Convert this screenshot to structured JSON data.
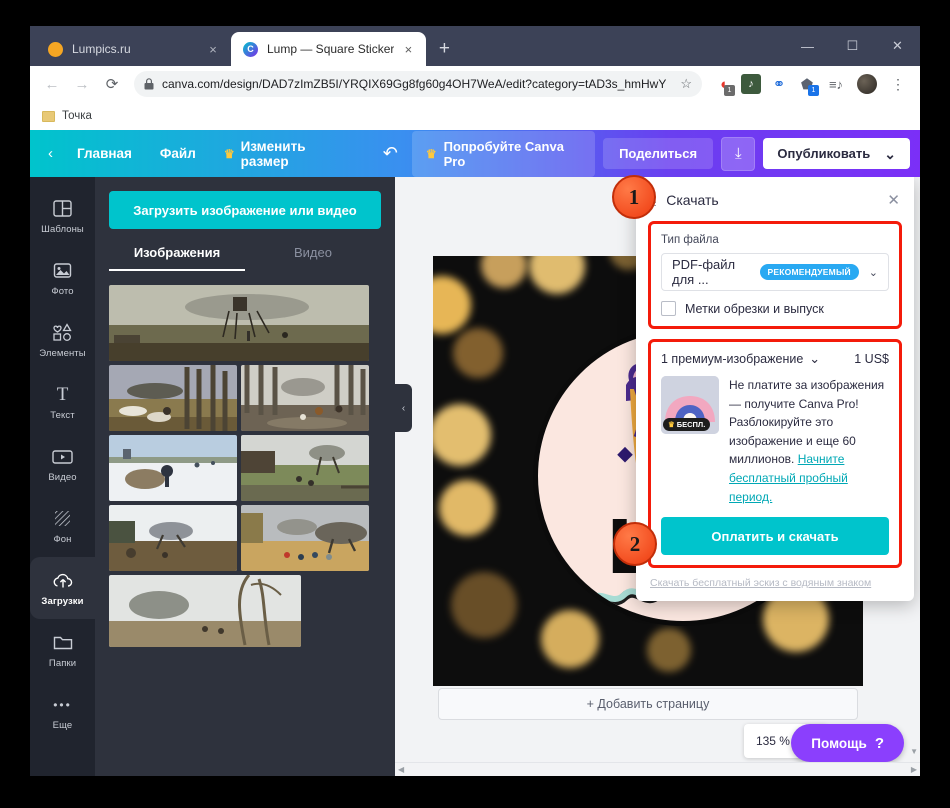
{
  "browser": {
    "tabs": [
      {
        "title": "Lumpics.ru",
        "favicon": "orange-dot-icon",
        "active": false,
        "close_label": "×"
      },
      {
        "title": "Lump — Square Sticker",
        "favicon": "canva-icon",
        "active": true,
        "close_label": "×"
      }
    ],
    "new_tab_label": "+",
    "window_controls": {
      "minimize": "—",
      "maximize": "☐",
      "close": "✕"
    },
    "nav": {
      "back": "←",
      "forward": "→",
      "reload": "⟳"
    },
    "omnibox": {
      "lock_icon": "lock-icon",
      "url": "canva.com/design/DAD7zImZB5I/YRQIX69Gg8fg60g4OH7WeA/edit?category=tAD3s_hmHwY",
      "star": "☆"
    },
    "extensions": [
      {
        "name": "recorder-extension-icon",
        "glyph": "◔",
        "color": "#e8372c",
        "badge": "1",
        "badge_color": "#6b6b6b"
      },
      {
        "name": "music-extension-icon",
        "glyph": "♫",
        "color": "#3d5a3d",
        "badge": "",
        "badge_color": ""
      },
      {
        "name": "globe-extension-icon",
        "glyph": "⊕",
        "color": "#1565d8",
        "badge": "",
        "badge_color": ""
      },
      {
        "name": "box-extension-icon",
        "glyph": "⬟",
        "color": "#5c6370",
        "badge": "1",
        "badge_color": "#1a73e8"
      }
    ],
    "downloads_icon": "downloads-list-icon",
    "profile_icon": "avatar-icon",
    "menu_icon": "⋮",
    "bookmarks": [
      {
        "label": "Точка",
        "icon": "folder-icon"
      }
    ]
  },
  "canva": {
    "toolbar": {
      "back_chevron": "‹",
      "home": "Главная",
      "file": "Файл",
      "resize": "Изменить размер",
      "crown": "♛",
      "undo": "↶",
      "try_pro": "Попробуйте Canva Pro",
      "share": "Поделиться",
      "download_icon": "⤓",
      "publish": "Опубликовать",
      "publish_chevron": "⌄"
    },
    "rail": [
      {
        "label": "Шаблоны",
        "icon": "templates-icon",
        "glyph": "◫",
        "active": false
      },
      {
        "label": "Фото",
        "icon": "photo-icon",
        "glyph": "⛰",
        "active": false
      },
      {
        "label": "Элементы",
        "icon": "elements-icon",
        "glyph": "⬡",
        "active": false
      },
      {
        "label": "Текст",
        "icon": "text-icon",
        "glyph": "T",
        "active": false
      },
      {
        "label": "Видео",
        "icon": "video-icon",
        "glyph": "▶",
        "active": false
      },
      {
        "label": "Фон",
        "icon": "background-icon",
        "glyph": "░",
        "active": false
      },
      {
        "label": "Загрузки",
        "icon": "uploads-cloud-icon",
        "glyph": "☁",
        "active": true
      },
      {
        "label": "Папки",
        "icon": "folders-icon",
        "glyph": "◱",
        "active": false
      },
      {
        "label": "Еще",
        "icon": "more-dots-icon",
        "glyph": "•••",
        "active": false
      }
    ],
    "uploads": {
      "upload_button": "Загрузить изображение или видео",
      "tabs": [
        {
          "label": "Изображения",
          "active": true
        },
        {
          "label": "Видео",
          "active": false
        }
      ],
      "collapse_chevron": "‹"
    },
    "editor": {
      "add_page": "+ Добавить страницу",
      "zoom_value": "135 %",
      "fit_icon": "⤡",
      "help_label": "Помощь",
      "help_mark": "?",
      "sticker_text": "LU"
    },
    "download_panel": {
      "icon": "⤓",
      "title": "Скачать",
      "close": "✕",
      "filetype_label": "Тип файла",
      "filetype_value": "PDF-файл для ...",
      "recommended_badge": "РЕКОМЕНДУЕМЫЙ",
      "filetype_chevron": "⌄",
      "crop_marks_label": "Метки обрезки и выпуск",
      "crop_marks_checked": false,
      "premium_count": "1 премиум-изображение",
      "premium_chevron": "⌄",
      "price": "1 US$",
      "free_tag": "БЕСПЛ.",
      "free_tag_crown": "♛",
      "promo_text": "Не платите за изображения — получите Canva Pro! Разблокируйте это изображение и еще 60 миллионов. ",
      "promo_link": "Начните бесплатный пробный период.",
      "pay_button": "Оплатить и скачать",
      "watermark_link": "Скачать бесплатный эскиз с водяным знаком"
    },
    "annotations": [
      {
        "label": "1"
      },
      {
        "label": "2"
      }
    ]
  },
  "colors": {
    "canva_teal": "#00c4cc",
    "canva_purple": "#7b2ff7",
    "highlight_red": "#f41b0a",
    "badge_orange": "#ee3b10",
    "help_purple": "#8b3ffd",
    "recommended_blue": "#29a9f2"
  }
}
